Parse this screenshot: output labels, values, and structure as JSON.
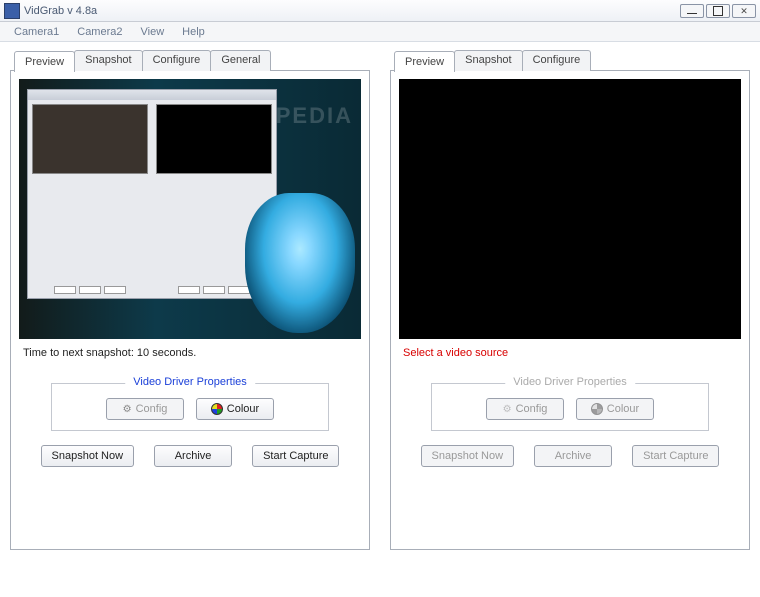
{
  "window": {
    "title": "VidGrab v 4.8a"
  },
  "menu": [
    "Camera1",
    "Camera2",
    "View",
    "Help"
  ],
  "tabs": [
    "Preview",
    "Snapshot",
    "Configure",
    "General"
  ],
  "tabs_right": [
    "Preview",
    "Snapshot",
    "Configure"
  ],
  "left": {
    "status": "Time to next snapshot:   10 seconds.",
    "group_title": "Video Driver Properties",
    "config_btn": "Config",
    "colour_btn": "Colour",
    "snapshot_btn": "Snapshot Now",
    "archive_btn": "Archive",
    "capture_btn": "Start Capture"
  },
  "right": {
    "status": "Select a video source",
    "group_title": "Video Driver Properties",
    "config_btn": "Config",
    "colour_btn": "Colour",
    "snapshot_btn": "Snapshot Now",
    "archive_btn": "Archive",
    "capture_btn": "Start Capture"
  },
  "watermark": "SOFTPEDIA"
}
